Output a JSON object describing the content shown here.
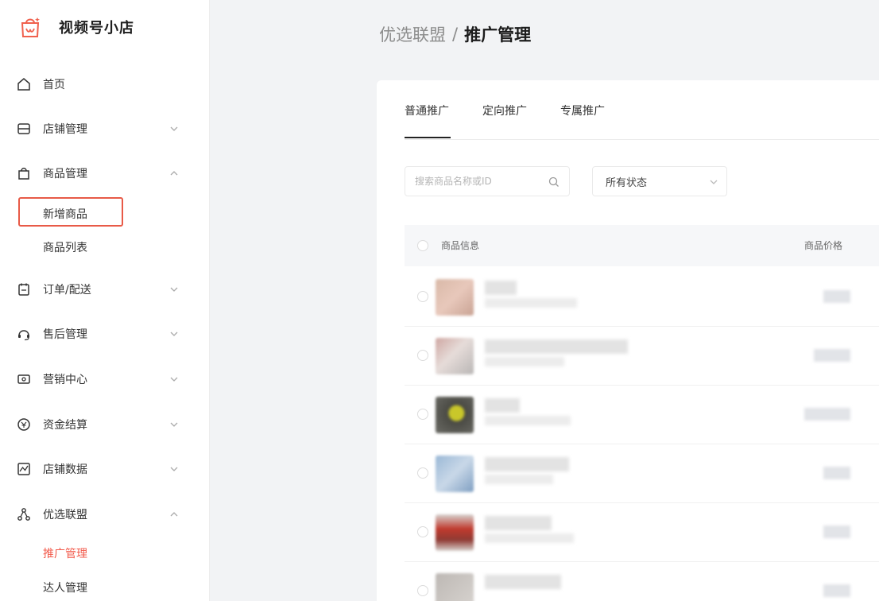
{
  "brand": {
    "name": "视频号小店",
    "accent": "#f0604d"
  },
  "sidebar": {
    "items": [
      {
        "label": "首页",
        "icon": "home-icon"
      },
      {
        "label": "店铺管理",
        "icon": "store-icon",
        "expanded": false
      },
      {
        "label": "商品管理",
        "icon": "bag-icon",
        "expanded": true
      },
      {
        "label": "订单/配送",
        "icon": "order-icon",
        "expanded": false
      },
      {
        "label": "售后管理",
        "icon": "headset-icon",
        "expanded": false
      },
      {
        "label": "营销中心",
        "icon": "coupon-icon",
        "expanded": false
      },
      {
        "label": "资金结算",
        "icon": "money-icon",
        "expanded": false
      },
      {
        "label": "店铺数据",
        "icon": "chart-icon",
        "expanded": false
      },
      {
        "label": "优选联盟",
        "icon": "share-icon",
        "expanded": true
      }
    ],
    "product_sub": [
      "新增商品",
      "商品列表"
    ],
    "alliance_sub": [
      "推广管理",
      "达人管理"
    ],
    "active_sub": "推广管理",
    "highlight_color": "#e85a47"
  },
  "breadcrumb": {
    "parent": "优选联盟",
    "separator": "/",
    "current": "推广管理"
  },
  "tabs": [
    {
      "label": "普通推广",
      "active": true
    },
    {
      "label": "定向推广",
      "active": false
    },
    {
      "label": "专属推广",
      "active": false
    }
  ],
  "filters": {
    "search_placeholder": "搜索商品名称或ID",
    "status_selected": "所有状态"
  },
  "table": {
    "columns": [
      "商品信息",
      "商品价格"
    ]
  }
}
